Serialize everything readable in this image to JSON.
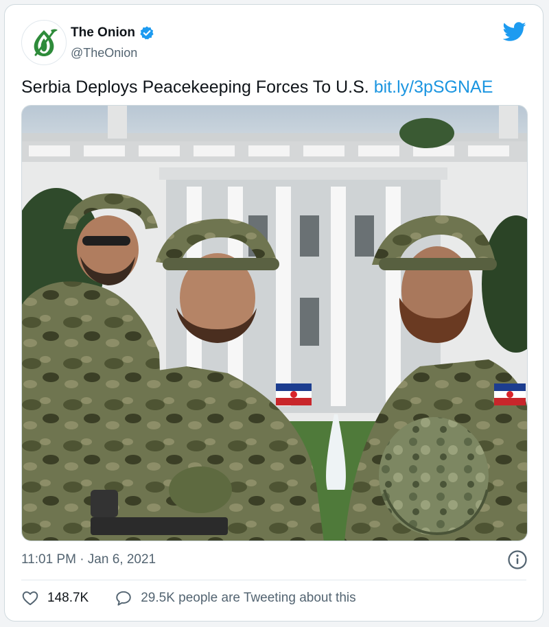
{
  "tweet": {
    "display_name": "The Onion",
    "handle": "@TheOnion",
    "verified": true,
    "text": "Serbia Deploys Peacekeeping Forces To U.S.",
    "link": "bit.ly/3pSGNAE",
    "timestamp": "11:01 PM · Jan 6, 2021",
    "likes": "148.7K",
    "tweeting_about": "29.5K people are Tweeting about this"
  },
  "icons": {
    "brand": "onion-logo-icon",
    "verified": "verified-badge-icon",
    "platform": "twitter-bird-icon",
    "info": "info-icon",
    "like": "heart-icon",
    "reply": "speech-bubble-icon"
  },
  "colors": {
    "link": "#1b95e0",
    "brand_green": "#2e8b3a",
    "verified": "#1d9bf0",
    "muted": "#536471"
  }
}
